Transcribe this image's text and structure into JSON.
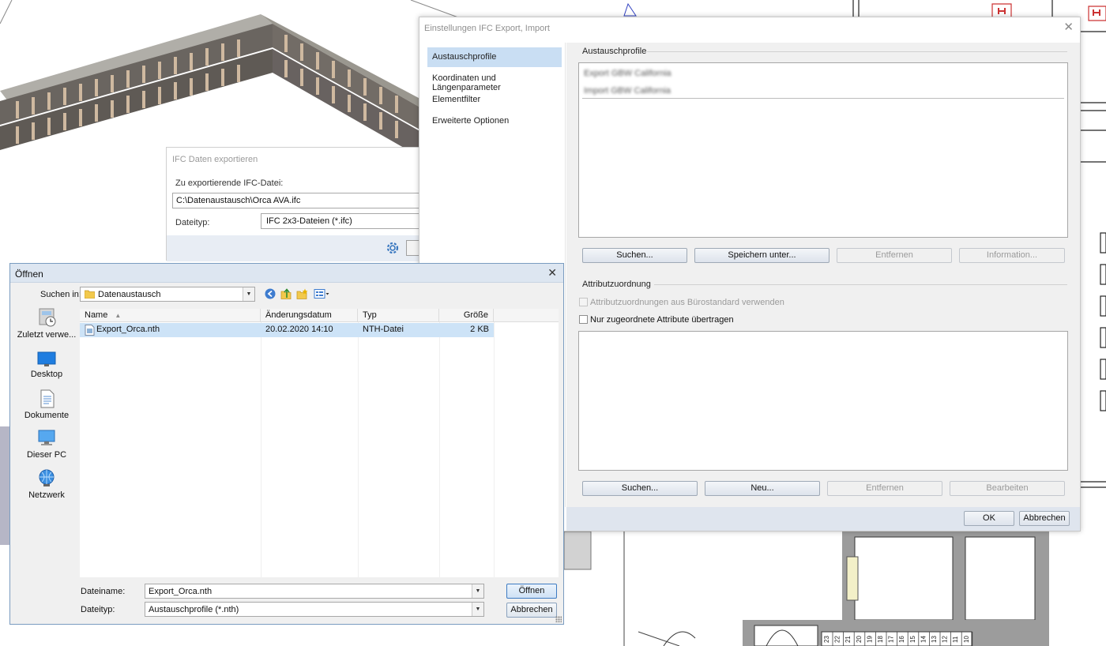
{
  "export_dialog": {
    "title": "IFC Daten exportieren",
    "file_label": "Zu exportierende IFC-Datei:",
    "file_value": "C:\\Datenaustausch\\Orca AVA.ifc",
    "type_label": "Dateityp:",
    "type_value": "IFC 2x3-Dateien (*.ifc)"
  },
  "settings_dialog": {
    "title": "Einstellungen IFC Export, Import",
    "close_icon": "close-icon",
    "nav": [
      {
        "label": "Austauschprofile",
        "active": true
      },
      {
        "label": "Koordinaten und Längenparameter",
        "active": false
      },
      {
        "label": "Elementfilter",
        "active": false
      },
      {
        "label": "Erweiterte Optionen",
        "active": false
      }
    ],
    "profiles": {
      "title": "Austauschprofile",
      "items": [
        "Export GBW California",
        "Import GBW California"
      ],
      "buttons": [
        {
          "label": "Suchen...",
          "enabled": true
        },
        {
          "label": "Speichern unter...",
          "enabled": true
        },
        {
          "label": "Entfernen",
          "enabled": false
        },
        {
          "label": "Information...",
          "enabled": false
        }
      ]
    },
    "attributes": {
      "title": "Attributzuordnung",
      "checkbox_office": "Attributzuordnungen aus Bürostandard verwenden",
      "checkbox_assigned": "Nur zugeordnete Attribute übertragen",
      "buttons": [
        {
          "label": "Suchen...",
          "enabled": true
        },
        {
          "label": "Neu...",
          "enabled": true
        },
        {
          "label": "Entfernen",
          "enabled": false
        },
        {
          "label": "Bearbeiten",
          "enabled": false
        }
      ]
    },
    "ok_label": "OK",
    "cancel_label": "Abbrechen"
  },
  "open_dialog": {
    "title": "Öffnen",
    "look_in_label": "Suchen in:",
    "look_in_value": "Datenaustausch",
    "places": [
      "Zuletzt verwe...",
      "Desktop",
      "Dokumente",
      "Dieser PC",
      "Netzwerk"
    ],
    "columns": [
      "Name",
      "Änderungsdatum",
      "Typ",
      "Größe"
    ],
    "files": [
      {
        "name": "Export_Orca.nth",
        "date": "20.02.2020 14:10",
        "type": "NTH-Datei",
        "size": "2 KB"
      }
    ],
    "filename_label": "Dateiname:",
    "filename_value": "Export_Orca.nth",
    "filetype_label": "Dateityp:",
    "filetype_value": "Austauschprofile (*.nth)",
    "open_label": "Öffnen",
    "cancel_label": "Abbrechen"
  },
  "cad_labels": [
    "23",
    "22",
    "21",
    "20",
    "19",
    "18",
    "17",
    "16",
    "15",
    "14",
    "13",
    "12",
    "11",
    "10"
  ]
}
